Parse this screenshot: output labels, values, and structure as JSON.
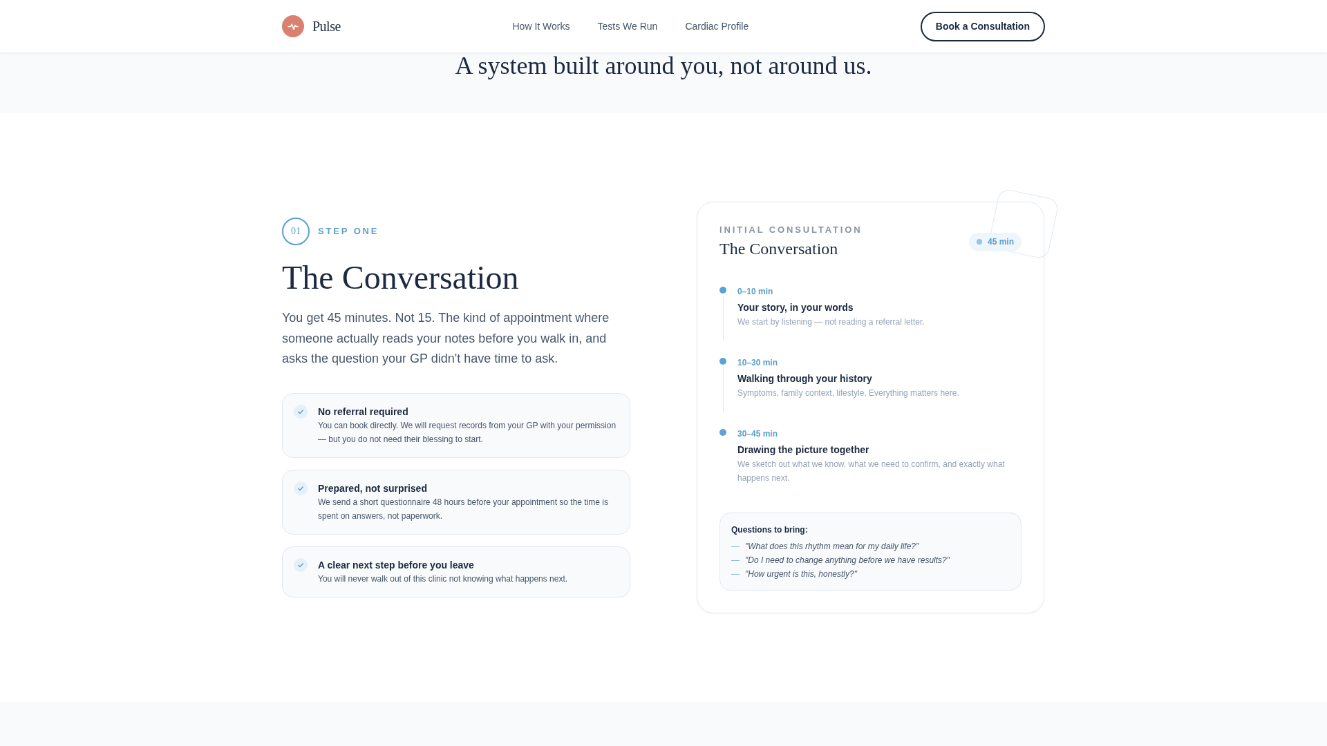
{
  "header": {
    "brand": "Pulse",
    "nav": [
      {
        "label": "How It Works"
      },
      {
        "label": "Tests We Run"
      },
      {
        "label": "Cardiac Profile"
      }
    ],
    "cta": "Book a Consultation"
  },
  "intro": {
    "heading": "A system built around you, not around us."
  },
  "step": {
    "number": "01",
    "label": "STEP ONE",
    "title": "The Conversation",
    "description": "You get 45 minutes. Not 15. The kind of appointment where someone actually reads your notes before you walk in, and asks the question your GP didn't have time to ask.",
    "features": [
      {
        "title": "No referral required",
        "description": "You can book directly. We will request records from your GP with your permission — but you do not need their blessing to start."
      },
      {
        "title": "Prepared, not surprised",
        "description": "We send a short questionnaire 48 hours before your appointment so the time is spent on answers, not paperwork."
      },
      {
        "title": "A clear next step before you leave",
        "description": "You will never walk out of this clinic not knowing what happens next."
      }
    ]
  },
  "consultation_card": {
    "label": "INITIAL CONSULTATION",
    "title": "The Conversation",
    "badge": "45 min",
    "timeline": [
      {
        "time": "0–10 min",
        "title": "Your story, in your words",
        "description": "We start by listening — not reading a referral letter."
      },
      {
        "time": "10–30 min",
        "title": "Walking through your history",
        "description": "Symptoms, family context, lifestyle. Everything matters here."
      },
      {
        "time": "30–45 min",
        "title": "Drawing the picture together",
        "description": "We sketch out what we know, what we need to confirm, and exactly what happens next."
      }
    ],
    "questions": {
      "title": "Questions to bring:",
      "items": [
        {
          "marker": "—",
          "text": "\"What does this rhythm mean for my daily life?\""
        },
        {
          "marker": "—",
          "text": "\"Do I need to change anything before we have results?\""
        },
        {
          "marker": "—",
          "text": "\"How urgent is this, honestly?\""
        }
      ]
    }
  }
}
